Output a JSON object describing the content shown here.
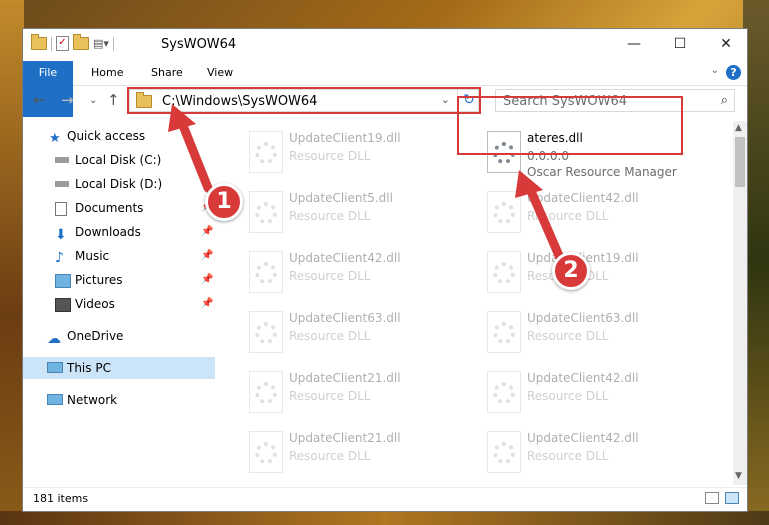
{
  "window": {
    "title": "SysWOW64"
  },
  "ribbon": {
    "tabs": [
      "File",
      "Home",
      "Share",
      "View"
    ],
    "help": "?"
  },
  "address": {
    "path": "C:\\Windows\\SysWOW64"
  },
  "search": {
    "placeholder": "Search SysWOW64"
  },
  "nav": {
    "items": [
      {
        "label": "Quick access",
        "icon": "star-icon"
      },
      {
        "label": "Local Disk (C:)",
        "icon": "drive-icon"
      },
      {
        "label": "Local Disk (D:)",
        "icon": "drive-icon"
      },
      {
        "label": "Documents",
        "icon": "documents-icon"
      },
      {
        "label": "Downloads",
        "icon": "download-icon"
      },
      {
        "label": "Music",
        "icon": "music-icon"
      },
      {
        "label": "Pictures",
        "icon": "pictures-icon"
      },
      {
        "label": "Videos",
        "icon": "videos-icon"
      },
      {
        "label": "OneDrive",
        "icon": "cloud-icon"
      },
      {
        "label": "This PC",
        "icon": "computer-icon"
      },
      {
        "label": "Network",
        "icon": "network-icon"
      }
    ]
  },
  "files": {
    "col1": [
      {
        "name": "UpdateClient19.dll",
        "type": "Resource DLL"
      },
      {
        "name": "UpdateClient5.dll",
        "type": "Resource DLL"
      },
      {
        "name": "UpdateClient42.dll",
        "type": "Resource DLL"
      },
      {
        "name": "UpdateClient63.dll",
        "type": "Resource DLL"
      },
      {
        "name": "UpdateClient21.dll",
        "type": "Resource DLL"
      },
      {
        "name": "UpdateClient21.dll",
        "type": "Resource DLL"
      }
    ],
    "highlight": {
      "name": "ateres.dll",
      "version": "0.0.0.0",
      "company": "Oscar Resource Manager"
    },
    "col2": [
      {
        "name": "UpdateClient42.dll",
        "type": "Resource DLL"
      },
      {
        "name": "UpdateClient19.dll",
        "type": "Resource DLL"
      },
      {
        "name": "UpdateClient63.dll",
        "type": "Resource DLL"
      },
      {
        "name": "UpdateClient42.dll",
        "type": "Resource DLL"
      },
      {
        "name": "UpdateClient42.dll",
        "type": "Resource DLL"
      }
    ]
  },
  "status": {
    "count": "181 items"
  },
  "callouts": [
    "1",
    "2"
  ],
  "colors": {
    "accent": "#1e6fc5",
    "highlight_red": "#d83a3a"
  }
}
